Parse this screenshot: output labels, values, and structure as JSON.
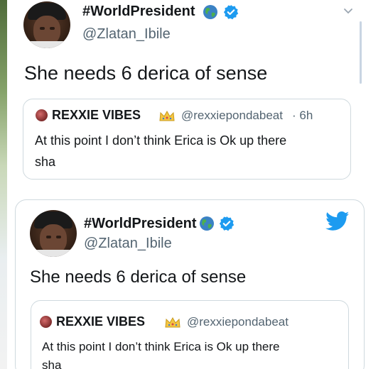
{
  "tweet_top": {
    "display_name": "#WorldPresident",
    "handle": "@Zlatan_Ibile",
    "text": "She needs 6 derica of sense",
    "quoted": {
      "display_name": "REXXIE VIBES",
      "handle": "@rexxiepondabeat",
      "time": "· 6h",
      "text_line1": "At this point I don’t think Erica is Ok up there",
      "text_line2": "sha"
    }
  },
  "tweet_card": {
    "display_name": "#WorldPresident",
    "handle": "@Zlatan_Ibile",
    "text": "She needs 6 derica of sense",
    "quoted": {
      "display_name": "REXXIE VIBES",
      "handle": "@rexxiepondabeat",
      "text_line1": "At this point I don’t think Erica is Ok up there",
      "text_line2": "sha"
    }
  },
  "icons": {
    "verified": "verified-badge-icon",
    "globe": "globe-emoji-icon",
    "crown": "crown-emoji-icon",
    "twitter": "twitter-bird-icon",
    "chevron": "chevron-down-icon"
  },
  "colors": {
    "twitter_blue": "#1d9bf0",
    "text": "#14171a",
    "secondary_text": "#536471",
    "border": "#cfd9de"
  }
}
